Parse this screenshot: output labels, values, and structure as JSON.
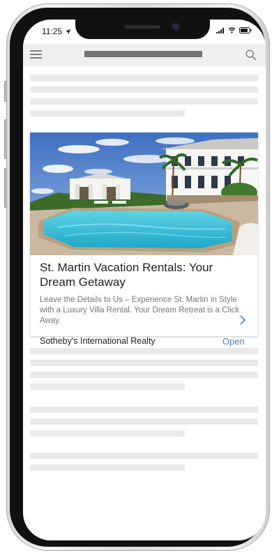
{
  "status_bar": {
    "time": "11:25",
    "location_icon": "location-arrow-icon",
    "signal_icon": "cellular-signal-icon",
    "wifi_icon": "wifi-icon",
    "battery_icon": "battery-icon"
  },
  "browser_bar": {
    "menu_icon": "hamburger-menu-icon",
    "search_icon": "search-icon"
  },
  "ad": {
    "image_icon": "villa-pool-photo",
    "headline": "St. Martin Vacation Rentals: Your Dream Getaway",
    "description": "Leave the Details to Us – Experience St. Martin in Style with a Luxury Villa Rental. Your Dream Retreat is a Click Away.",
    "advertiser": "Sotheby's International Realty",
    "cta_label": "Open",
    "chevron_icon": "chevron-right-icon"
  },
  "colors": {
    "accent": "#4a7fc1",
    "placeholder": "#e9e9ea",
    "browser_bar": "#efefef",
    "url_placeholder": "#737373"
  }
}
